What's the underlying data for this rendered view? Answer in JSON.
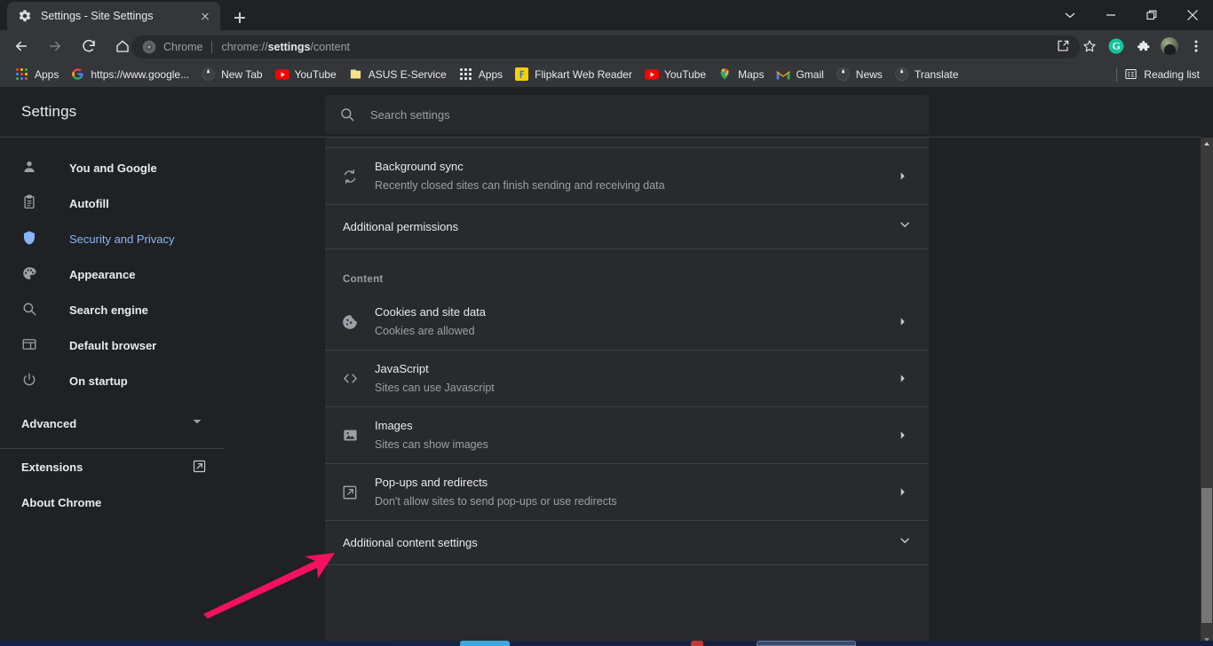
{
  "window": {
    "controls": [
      {
        "name": "minimize-to-tray",
        "glyph": "chevron-down"
      },
      {
        "name": "minimize",
        "glyph": "minus"
      },
      {
        "name": "restore",
        "glyph": "square"
      },
      {
        "name": "close",
        "glyph": "cross"
      }
    ]
  },
  "tab": {
    "title": "Settings - Site Settings",
    "favicon": "gear-icon",
    "close_label": "Close",
    "newtab_label": "New Tab"
  },
  "toolbar": {
    "back_label": "Back",
    "forward_label": "Forward",
    "reload_label": "Reload",
    "home_label": "Home",
    "omnibox": {
      "chip": "Chrome",
      "url_prefix": "chrome://",
      "url_bold": "settings",
      "url_suffix": "/content",
      "full_url": "chrome://settings/content"
    },
    "right_icons": [
      {
        "name": "share-icon",
        "label": "Share this page"
      },
      {
        "name": "star-icon",
        "label": "Bookmark this tab"
      },
      {
        "name": "grammarly-extension-icon",
        "label": "G"
      },
      {
        "name": "puzzle-icon",
        "label": "Extensions"
      },
      {
        "name": "avatar-icon",
        "label": "Profile"
      },
      {
        "name": "three-dot-menu-icon",
        "label": "Customize and control Google Chrome"
      }
    ]
  },
  "bookmarks": {
    "items": [
      {
        "label": "Apps",
        "icon": "apps-grid-icon"
      },
      {
        "label": "https://www.google...",
        "icon": "google-icon"
      },
      {
        "label": "New Tab",
        "icon": "globe-icon"
      },
      {
        "label": "YouTube",
        "icon": "youtube-icon"
      },
      {
        "label": "ASUS E-Service",
        "icon": "folder-icon"
      },
      {
        "label": "Apps",
        "icon": "apps-grid-icon"
      },
      {
        "label": "Flipkart Web Reader",
        "icon": "flipkart-icon"
      },
      {
        "label": "YouTube",
        "icon": "youtube-icon"
      },
      {
        "label": "Maps",
        "icon": "maps-pin-icon"
      },
      {
        "label": "Gmail",
        "icon": "gmail-icon"
      },
      {
        "label": "News",
        "icon": "globe-icon"
      },
      {
        "label": "Translate",
        "icon": "globe-icon"
      }
    ],
    "reading_list": {
      "label": "Reading list",
      "icon": "reading-list-icon"
    }
  },
  "settings": {
    "title": "Settings",
    "search": {
      "placeholder": "Search settings",
      "value": "",
      "icon": "search-icon"
    },
    "sidebar": {
      "items": [
        {
          "label": "You and Google",
          "icon": "person-icon",
          "active": false
        },
        {
          "label": "Autofill",
          "icon": "clipboard-icon",
          "active": false
        },
        {
          "label": "Security and Privacy",
          "icon": "shield-icon",
          "active": true
        },
        {
          "label": "Appearance",
          "icon": "palette-icon",
          "active": false
        },
        {
          "label": "Search engine",
          "icon": "search-icon",
          "active": false
        },
        {
          "label": "Default browser",
          "icon": "browser-window-icon",
          "active": false
        },
        {
          "label": "On startup",
          "icon": "power-icon",
          "active": false
        }
      ],
      "advanced": {
        "label": "Advanced",
        "icon": "chevron-down-icon"
      },
      "footer": [
        {
          "label": "Extensions",
          "icon": "external-link-icon"
        },
        {
          "label": "About Chrome",
          "icon": ""
        }
      ]
    },
    "main": {
      "rows_top": [
        {
          "title": "Background sync",
          "subtitle": "Recently closed sites can finish sending and receiving data",
          "icon": "sync-icon",
          "arrow": "chevron-right-icon"
        }
      ],
      "additional_permissions": {
        "label": "Additional permissions",
        "icon": "chevron-down-icon"
      },
      "content_section_label": "Content",
      "content_rows": [
        {
          "title": "Cookies and site data",
          "subtitle": "Cookies are allowed",
          "icon": "cookie-icon",
          "arrow": "chevron-right-icon"
        },
        {
          "title": "JavaScript",
          "subtitle": "Sites can use Javascript",
          "icon": "code-brackets-icon",
          "arrow": "chevron-right-icon"
        },
        {
          "title": "Images",
          "subtitle": "Sites can show images",
          "icon": "image-icon",
          "arrow": "chevron-right-icon"
        },
        {
          "title": "Pop-ups and redirects",
          "subtitle": "Don't allow sites to send pop-ups or use redirects",
          "icon": "popup-redirect-icon",
          "arrow": "chevron-right-icon"
        }
      ],
      "additional_content_settings": {
        "label": "Additional content settings",
        "icon": "chevron-down-icon"
      }
    }
  },
  "annotation": {
    "type": "arrow",
    "color": "#F5115E",
    "points_to": "Additional content settings"
  },
  "colors": {
    "page_background": "#202124",
    "card_background": "#292a2d",
    "toolbar_background": "#35363a",
    "divider": "#3c4043",
    "text_primary": "#e8eaed",
    "text_secondary": "#9aa0a6",
    "accent_blue": "#8ab4f8",
    "annotation_pink": "#F5115E"
  }
}
